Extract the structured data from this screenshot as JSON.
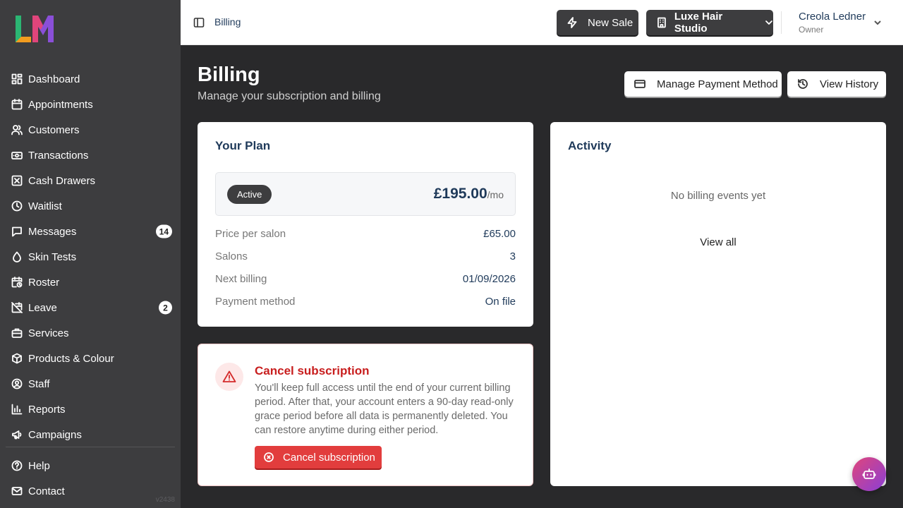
{
  "brand": {
    "logo_text": "LM",
    "version": "v2438"
  },
  "sidebar": {
    "items": [
      {
        "label": "Dashboard",
        "icon": "dashboard-icon"
      },
      {
        "label": "Appointments",
        "icon": "calendar-icon"
      },
      {
        "label": "Customers",
        "icon": "users-icon"
      },
      {
        "label": "Transactions",
        "icon": "banknote-icon"
      },
      {
        "label": "Cash Drawers",
        "icon": "cash-drawer-icon"
      },
      {
        "label": "Waitlist",
        "icon": "clock-icon"
      },
      {
        "label": "Messages",
        "icon": "message-icon",
        "badge": "14"
      },
      {
        "label": "Skin Tests",
        "icon": "droplet-icon"
      },
      {
        "label": "Roster",
        "icon": "calendar-clock-icon"
      },
      {
        "label": "Leave",
        "icon": "calendar-off-icon",
        "badge": "2"
      },
      {
        "label": "Services",
        "icon": "briefcase-icon"
      },
      {
        "label": "Products & Colour",
        "icon": "package-icon"
      },
      {
        "label": "Staff",
        "icon": "user-circle-icon"
      },
      {
        "label": "Reports",
        "icon": "chart-icon"
      },
      {
        "label": "Campaigns",
        "icon": "megaphone-icon"
      }
    ],
    "bottom_items": [
      {
        "label": "Help",
        "icon": "help-icon"
      },
      {
        "label": "Contact",
        "icon": "mail-icon"
      }
    ]
  },
  "topbar": {
    "breadcrumb": "Billing",
    "new_sale_label": "New Sale",
    "studio_name": "Luxe Hair Studio",
    "user_name": "Creola Ledner",
    "user_role": "Owner"
  },
  "page": {
    "title": "Billing",
    "subtitle": "Manage your subscription and billing",
    "manage_payment_label": "Manage Payment Method",
    "view_history_label": "View History"
  },
  "plan": {
    "title": "Your Plan",
    "status": "Active",
    "price": "£195.00",
    "period": "/mo",
    "rows": [
      {
        "label": "Price per salon",
        "value": "£65.00"
      },
      {
        "label": "Salons",
        "value": "3"
      },
      {
        "label": "Next billing",
        "value": "01/09/2026"
      },
      {
        "label": "Payment method",
        "value": "On file"
      }
    ]
  },
  "cancel": {
    "title": "Cancel subscription",
    "text": "You'll keep full access until the end of your current billing period. After that, your account enters a 90-day read-only grace period before all data is permanently deleted. You can restore anytime during either period.",
    "button_label": "Cancel subscription"
  },
  "activity": {
    "title": "Activity",
    "empty_text": "No billing events yet",
    "view_all_label": "View all"
  },
  "colors": {
    "sidebar_bg": "#3d3d3f",
    "page_bg": "#29292b",
    "accent_navy": "#1f3a5a",
    "danger": "#e23d3d"
  }
}
